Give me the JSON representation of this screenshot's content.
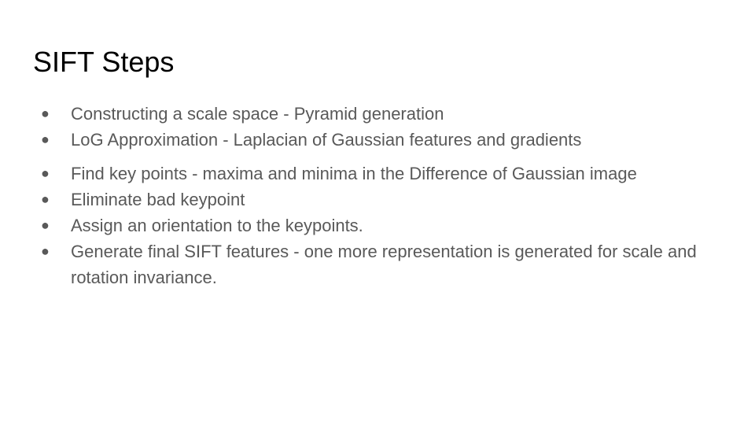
{
  "slide": {
    "title": "SIFT Steps",
    "bullet_glyph": "●",
    "bullets": [
      {
        "text": "Constructing a scale space - Pyramid generation"
      },
      {
        "text": "LoG Approximation - Laplacian of Gaussian features and gradients"
      },
      {
        "text": "Find key points - maxima and minima in the Difference of Gaussian image"
      },
      {
        "text": "Eliminate bad keypoint"
      },
      {
        "text": "Assign an orientation to the keypoints."
      },
      {
        "text": "Generate final SIFT features - one more representation is generated for scale and rotation invariance."
      }
    ]
  },
  "colors": {
    "title": "#000000",
    "body_text": "#595959",
    "background": "#ffffff"
  }
}
